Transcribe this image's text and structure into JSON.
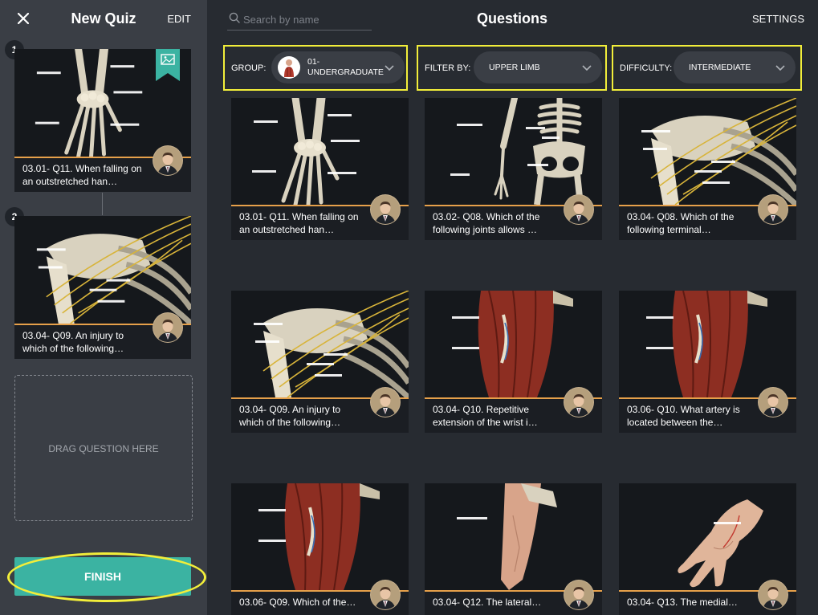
{
  "sidebar": {
    "title": "New Quiz",
    "edit_label": "EDIT",
    "close_icon": "close-icon",
    "selected": [
      {
        "number": "1",
        "label": "03.01- Q11. When falling on an outstretched han…",
        "art": "hand"
      },
      {
        "number": "2",
        "label": "03.04- Q09. An injury to which of the following…",
        "art": "shoulder"
      }
    ],
    "drop_zone_label": "DRAG QUESTION HERE",
    "finish_label": "FINISH"
  },
  "main": {
    "search_placeholder": "Search by name",
    "title": "Questions",
    "settings_label": "SETTINGS",
    "filters": {
      "group": {
        "label": "GROUP:",
        "value": "01- UNDERGRADUATE"
      },
      "filter_by": {
        "label": "FILTER BY:",
        "value": "UPPER LIMB"
      },
      "difficulty": {
        "label": "DIFFICULTY:",
        "value": "INTERMEDIATE"
      }
    },
    "questions": [
      {
        "label": "03.01- Q11. When falling on an outstretched han…",
        "art": "hand"
      },
      {
        "label": "03.02- Q08. Which of the following joints allows …",
        "art": "skeleton"
      },
      {
        "label": "03.04- Q08. Which of the following terminal…",
        "art": "shoulder"
      },
      {
        "label": "03.04- Q09. An injury to which of the following…",
        "art": "shoulder"
      },
      {
        "label": "03.04- Q10. Repetitive extension of the wrist i…",
        "art": "muscle"
      },
      {
        "label": "03.06- Q10. What artery is located between the…",
        "art": "muscle"
      },
      {
        "label": "03.06- Q09. Which of the…",
        "art": "muscle"
      },
      {
        "label": "03.04- Q12. The lateral…",
        "art": "arm"
      },
      {
        "label": "03.04- Q13. The medial…",
        "art": "palm"
      }
    ]
  },
  "colors": {
    "highlight": "#f2ee3a",
    "accent": "#e6a04a",
    "finish": "#3bb3a2"
  }
}
